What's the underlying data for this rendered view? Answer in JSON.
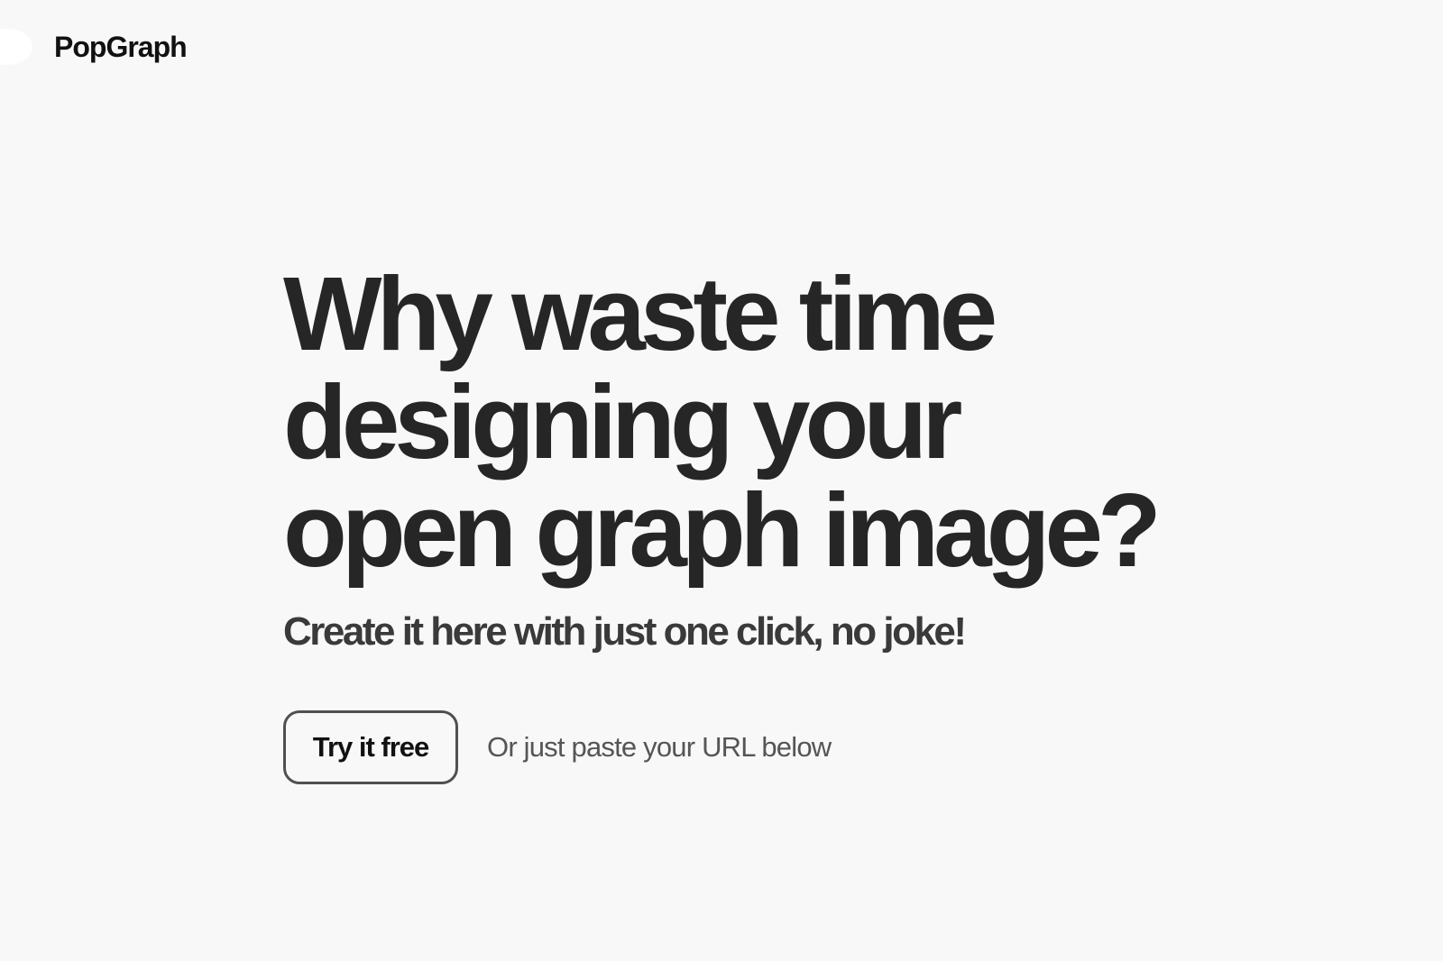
{
  "header": {
    "brand_name": "PopGraph",
    "logo_icon": "logo-circle"
  },
  "hero": {
    "headline_lines": [
      "Why waste time",
      "designing your",
      "open graph image?"
    ],
    "subheadline": "Create it here with just one click, no joke!",
    "cta": {
      "button_label": "Try it free",
      "hint": "Or just paste your URL below"
    }
  },
  "colors": {
    "background": "#f8f8f8",
    "text_primary": "#262626",
    "text_secondary": "#555555",
    "button_border": "#505050"
  }
}
